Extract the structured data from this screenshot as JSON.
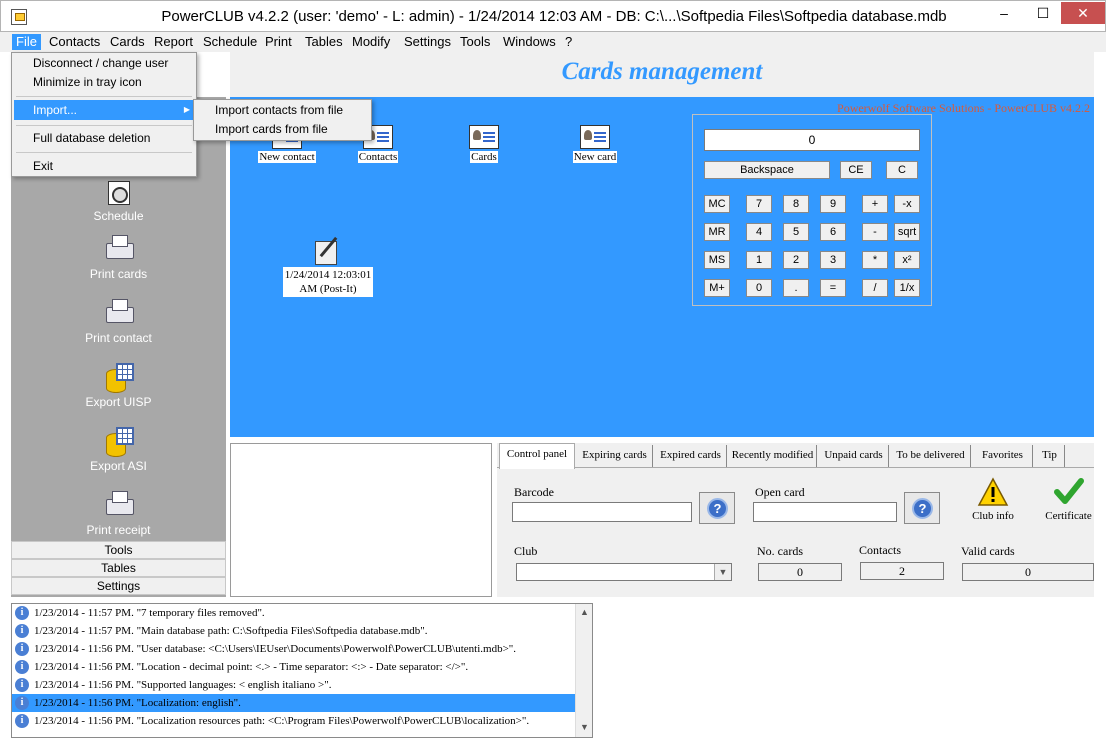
{
  "window": {
    "title": "PowerCLUB v4.2.2  (user: 'demo'  - L: admin) - 1/24/2014 12:03 AM - DB: C:\\...\\Softpedia Files\\Softpedia database.mdb",
    "minimize": "–",
    "maximize": "☐",
    "close": "✕"
  },
  "menubar": {
    "items": [
      "File",
      "Contacts",
      "Cards",
      "Report",
      "Schedule",
      "Print",
      "Tables",
      "Modify",
      "Settings",
      "Tools",
      "Windows",
      "?"
    ]
  },
  "file_menu": {
    "items": [
      "Disconnect / change user",
      "Minimize in tray icon",
      "Import...",
      "Full database deletion",
      "Exit"
    ],
    "submenu_arrow": "▶",
    "import_submenu": [
      "Import contacts from file",
      "Import cards from file"
    ]
  },
  "header": {
    "title": "Cards management"
  },
  "main": {
    "brand": "Powerwolf Software Solutions - PowerCLUB v4.2.2",
    "desktop_icons": {
      "new_contact": "New contact",
      "contacts": "Contacts",
      "cards": "Cards",
      "new_card": "New card",
      "postit_line1": "1/24/2014 12:03:01",
      "postit_line2": "AM (Post-It)"
    }
  },
  "calculator": {
    "display": "0",
    "backspace": "Backspace",
    "ce": "CE",
    "c": "C",
    "mc": "MC",
    "mr": "MR",
    "ms": "MS",
    "mplus": "M+",
    "d7": "7",
    "d8": "8",
    "d9": "9",
    "d4": "4",
    "d5": "5",
    "d6": "6",
    "d1": "1",
    "d2": "2",
    "d3": "3",
    "d0": "0",
    "dot": ".",
    "eq": "=",
    "plus": "+",
    "minus": "-",
    "mul": "*",
    "div": "/",
    "negx": "-x",
    "sqrt": "sqrt",
    "sq": "x²",
    "inv": "1/x"
  },
  "sidebar": {
    "tools": [
      "Schedule",
      "Print cards",
      "Print contact",
      "Export UISP",
      "Export ASI",
      "Print receipt"
    ],
    "sections": [
      "Tools",
      "Tables",
      "Settings"
    ]
  },
  "tabs": {
    "labels": [
      "Control panel",
      "Expiring cards",
      "Expired cards",
      "Recently modified",
      "Unpaid cards",
      "To be delivered",
      "Favorites",
      "Tip"
    ],
    "active": "Control panel"
  },
  "control_panel": {
    "barcode_label": "Barcode",
    "open_card_label": "Open card",
    "help_glyph": "?",
    "club_info": "Club info",
    "certificate": "Certificate",
    "club_label": "Club",
    "no_cards_label": "No. cards",
    "no_cards_value": "0",
    "contacts_label": "Contacts",
    "contacts_value": "2",
    "valid_cards_label": "Valid cards",
    "valid_cards_value": "0"
  },
  "log": {
    "icon_glyph": "i",
    "entries": [
      "1/23/2014 - 11:57 PM. \"7 temporary files removed\".",
      "1/23/2014 - 11:57 PM. \"Main database path: C:\\Softpedia Files\\Softpedia database.mdb\".",
      "1/23/2014 - 11:56 PM. \"User database: <C:\\Users\\IEUser\\Documents\\Powerwolf\\PowerCLUB\\utenti.mdb>\".",
      "1/23/2014 - 11:56 PM. \"Location - decimal point: <.> - Time separator: <:> - Date separator: </>\".",
      "1/23/2014 - 11:56 PM. \"Supported languages: < english italiano >\".",
      "1/23/2014 - 11:56 PM. \"Localization: english\".",
      "1/23/2014 - 11:56 PM. \"Localization resources path: <C:\\Program Files\\Powerwolf\\PowerCLUB\\localization>\"."
    ],
    "selected_index": 5,
    "scroll_up": "▲",
    "scroll_down": "▼"
  },
  "colors": {
    "accent": "#3399ff",
    "sidebar": "#a8a8a8",
    "brand": "#d85a3a"
  }
}
